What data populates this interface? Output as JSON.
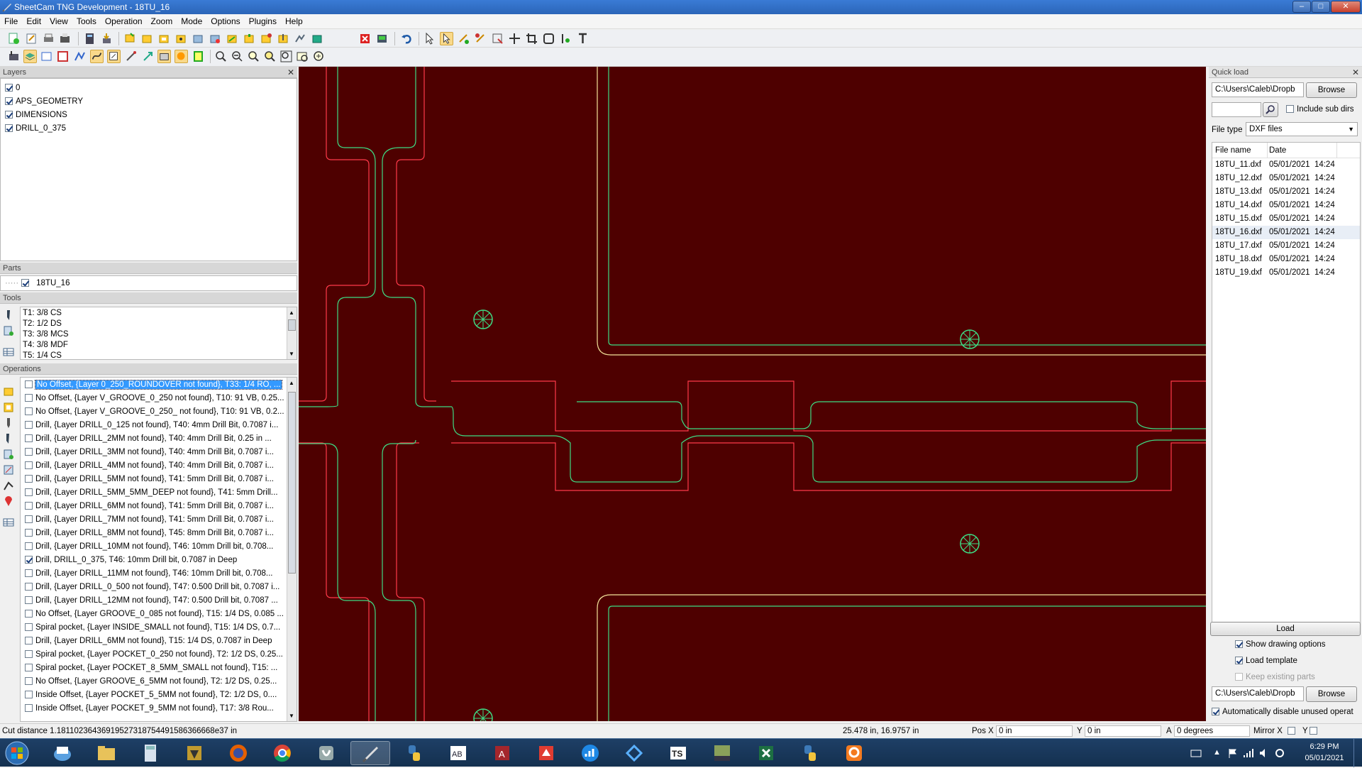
{
  "window": {
    "title": "SheetCam TNG Development - 18TU_16",
    "min": "–",
    "max": "□",
    "close": "✕"
  },
  "menu": [
    "File",
    "Edit",
    "View",
    "Tools",
    "Operation",
    "Zoom",
    "Mode",
    "Options",
    "Plugins",
    "Help"
  ],
  "layers": {
    "title": "Layers",
    "items": [
      {
        "label": "0",
        "checked": true
      },
      {
        "label": "APS_GEOMETRY",
        "checked": true
      },
      {
        "label": "DIMENSIONS",
        "checked": true
      },
      {
        "label": "DRILL_0_375",
        "checked": true
      }
    ]
  },
  "parts": {
    "title": "Parts",
    "items": [
      {
        "label": "18TU_16",
        "checked": true
      }
    ]
  },
  "tools": {
    "title": "Tools",
    "items": [
      "T1: 3/8 CS",
      "T2: 1/2 DS",
      "T3: 3/8 MCS",
      "T4: 3/8 MDF",
      "T5: 1/4 CS"
    ]
  },
  "operations": {
    "title": "Operations",
    "items": [
      {
        "label": "No Offset, {Layer 0_250_ROUNDOVER  not found}, T33: 1/4 RO, ...",
        "checked": false,
        "selected": true
      },
      {
        "label": "No Offset, {Layer V_GROOVE_0_250  not found}, T10: 91 VB, 0.25...",
        "checked": false
      },
      {
        "label": "No Offset, {Layer V_GROOVE_0_250_  not found}, T10: 91 VB, 0.2...",
        "checked": false
      },
      {
        "label": "Drill, {Layer DRILL_0_125  not found}, T40: 4mm Drill Bit, 0.7087 i...",
        "checked": false
      },
      {
        "label": "Drill, {Layer DRILL_2MM  not found}, T40: 4mm Drill Bit, 0.25 in ...",
        "checked": false
      },
      {
        "label": "Drill, {Layer DRILL_3MM  not found}, T40: 4mm Drill Bit, 0.7087 i...",
        "checked": false
      },
      {
        "label": "Drill, {Layer DRILL_4MM  not found}, T40: 4mm Drill Bit, 0.7087 i...",
        "checked": false
      },
      {
        "label": "Drill, {Layer DRILL_5MM  not found}, T41: 5mm Drill Bit, 0.7087 i...",
        "checked": false
      },
      {
        "label": "Drill, {Layer DRILL_5MM_5MM_DEEP  not found}, T41: 5mm Drill...",
        "checked": false
      },
      {
        "label": "Drill, {Layer DRILL_6MM  not found}, T41: 5mm Drill Bit, 0.7087 i...",
        "checked": false
      },
      {
        "label": "Drill, {Layer DRILL_7MM  not found}, T41: 5mm Drill Bit, 0.7087 i...",
        "checked": false
      },
      {
        "label": "Drill, {Layer DRILL_8MM  not found}, T45: 8mm Drill Bit, 0.7087 i...",
        "checked": false
      },
      {
        "label": "Drill, {Layer DRILL_10MM  not found}, T46: 10mm Drill bit, 0.708...",
        "checked": false
      },
      {
        "label": "Drill, DRILL_0_375, T46: 10mm Drill bit, 0.7087 in Deep",
        "checked": true
      },
      {
        "label": "Drill, {Layer DRILL_11MM  not found}, T46: 10mm Drill bit, 0.708...",
        "checked": false
      },
      {
        "label": "Drill, {Layer DRILL_0_500  not found}, T47: 0.500 Drill bit, 0.7087 i...",
        "checked": false
      },
      {
        "label": "Drill, {Layer DRILL_12MM  not found}, T47: 0.500 Drill bit, 0.7087 ...",
        "checked": false
      },
      {
        "label": "No Offset, {Layer GROOVE_0_085  not found}, T15: 1/4 DS, 0.085 ...",
        "checked": false
      },
      {
        "label": "Spiral pocket, {Layer INSIDE_SMALL  not found}, T15: 1/4 DS, 0.7...",
        "checked": false
      },
      {
        "label": "Drill, {Layer DRILL_6MM  not found}, T15: 1/4 DS, 0.7087 in Deep",
        "checked": false
      },
      {
        "label": "Spiral pocket, {Layer POCKET_0_250  not found}, T2: 1/2 DS, 0.25...",
        "checked": false
      },
      {
        "label": "Spiral pocket, {Layer POCKET_8_5MM_SMALL  not found}, T15: ...",
        "checked": false
      },
      {
        "label": "No Offset, {Layer GROOVE_6_5MM  not found}, T2: 1/2 DS, 0.25...",
        "checked": false
      },
      {
        "label": "Inside Offset, {Layer POCKET_5_5MM  not found}, T2: 1/2 DS, 0....",
        "checked": false
      },
      {
        "label": "Inside Offset, {Layer POCKET_9_5MM  not found}, T17: 3/8 Rou...",
        "checked": false
      }
    ]
  },
  "quickload": {
    "title": "Quick load",
    "path": "C:\\Users\\Caleb\\Dropb",
    "browse": "Browse",
    "include_sub": "Include sub dirs",
    "include_sub_checked": false,
    "filetype_label": "File type",
    "filetype_value": "DXF files",
    "col_name": "File name",
    "col_date": "Date",
    "files": [
      {
        "name": "18TU_11.dxf",
        "date": "05/01/2021  14:24"
      },
      {
        "name": "18TU_12.dxf",
        "date": "05/01/2021  14:24"
      },
      {
        "name": "18TU_13.dxf",
        "date": "05/01/2021  14:24"
      },
      {
        "name": "18TU_14.dxf",
        "date": "05/01/2021  14:24"
      },
      {
        "name": "18TU_15.dxf",
        "date": "05/01/2021  14:24"
      },
      {
        "name": "18TU_16.dxf",
        "date": "05/01/2021  14:24",
        "selected": true
      },
      {
        "name": "18TU_17.dxf",
        "date": "05/01/2021  14:24"
      },
      {
        "name": "18TU_18.dxf",
        "date": "05/01/2021  14:24"
      },
      {
        "name": "18TU_19.dxf",
        "date": "05/01/2021  14:24"
      }
    ],
    "load": "Load",
    "show_drawing": "Show drawing options",
    "load_template": "Load template",
    "keep_existing": "Keep existing parts",
    "template_path": "C:\\Users\\Caleb\\Dropb",
    "browse2": "Browse",
    "auto_disable": "Automatically disable unused operat"
  },
  "status": {
    "cut_distance": "Cut distance 1.18110236436919527318754491586366668​e37 in",
    "coords": "25.478 in, 16.9757 in",
    "posx_label": "Pos X",
    "posx": "0 in",
    "y_label": "Y",
    "y": "0 in",
    "a_label": "A",
    "a": "0 degrees",
    "mirrorx_label": "Mirror X",
    "mirrory_label": "Y"
  },
  "taskbar": {
    "time": "6:29 PM",
    "date": "05/01/2021"
  },
  "colors": {
    "canvas": "#4e0000",
    "toolpath": "#ff3a4a",
    "geometry": "#3ddc84",
    "outline": "#f3e39a",
    "selection": "#3399ff"
  }
}
